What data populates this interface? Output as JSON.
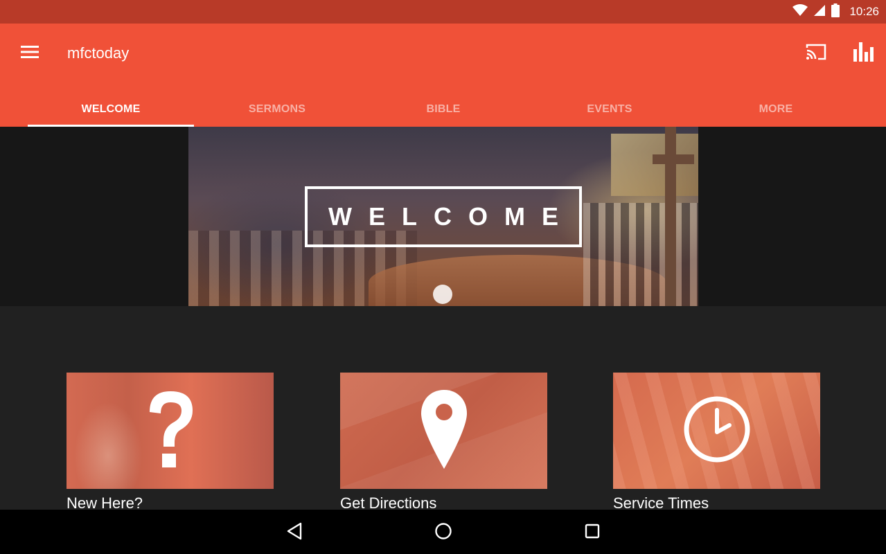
{
  "status_bar": {
    "time": "10:26",
    "icons": [
      "wifi-icon",
      "cell-signal-icon",
      "battery-icon"
    ]
  },
  "app_bar": {
    "title": "mfctoday",
    "icons": [
      "menu-icon",
      "cast-icon",
      "bar-chart-icon"
    ],
    "background_color": "#f05138"
  },
  "tabs": [
    {
      "label": "WELCOME",
      "active": true
    },
    {
      "label": "SERMONS",
      "active": false
    },
    {
      "label": "BIBLE",
      "active": false
    },
    {
      "label": "EVENTS",
      "active": false
    },
    {
      "label": "MORE",
      "active": false
    }
  ],
  "hero": {
    "text": "WELCOME"
  },
  "tiles": [
    {
      "label": "New Here?",
      "icon": "question-mark-icon"
    },
    {
      "label": "Get Directions",
      "icon": "map-pin-icon"
    },
    {
      "label": "Service Times",
      "icon": "clock-icon"
    }
  ],
  "nav_bar": {
    "icons": [
      "back-icon",
      "home-icon",
      "recents-icon"
    ]
  }
}
